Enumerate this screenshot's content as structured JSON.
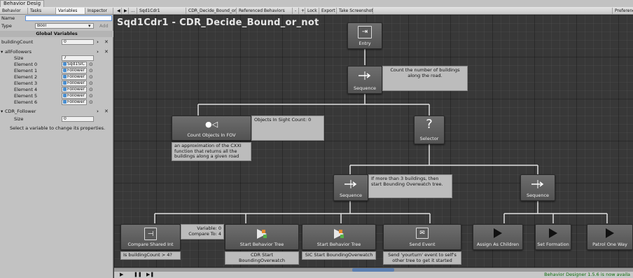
{
  "window": {
    "tab_title": "Behavior Desig"
  },
  "panel_tabs": [
    "Behavior",
    "Tasks",
    "Variables",
    "Inspector"
  ],
  "toolbar": {
    "prev": "◀",
    "next": "▶",
    "ellipsis": "...",
    "tree": "Sqd1Cdr1",
    "tree_dropdown": "CDR_Decide_Bound_or_",
    "referenced": "Referenced Behaviors",
    "minus": "-",
    "plus": "+",
    "lock": "Lock",
    "export": "Export",
    "screenshot": "Take Screenshot",
    "preferences": "Preferences"
  },
  "variables": {
    "name_label": "Name",
    "name_value": "",
    "type_label": "Type",
    "type_value": "Bool",
    "add_label": "Add",
    "global_label": "Global Variables",
    "list": [
      {
        "name": "buildingCount",
        "value": "0"
      }
    ],
    "allFollowers": {
      "name": "allFollowers",
      "size_label": "Size",
      "size_value": "7",
      "elements": [
        {
          "label": "Element 0",
          "value": "Sqd1SIC"
        },
        {
          "label": "Element 1",
          "value": "Follower"
        },
        {
          "label": "Element 2",
          "value": "Follower"
        },
        {
          "label": "Element 3",
          "value": "Follower"
        },
        {
          "label": "Element 4",
          "value": "Follower"
        },
        {
          "label": "Element 5",
          "value": "Follower"
        },
        {
          "label": "Element 6",
          "value": "Follower"
        }
      ]
    },
    "cdrFollower": {
      "name": "CDR_Follower",
      "size_label": "Size",
      "size_value": "0"
    },
    "hint": "Select a variable to change its properties."
  },
  "graph": {
    "title": "Sqd1Cdr1 - CDR_Decide_Bound_or_not",
    "nodes": {
      "entry": "Entry",
      "sequence_root": "Sequence",
      "count_objects": "Count Objects In FOV",
      "selector": "Selector",
      "sequence_left": "Sequence",
      "sequence_right": "Sequence",
      "compare": "Compare Shared Int",
      "start_bt_1": "Start Behavior Tree",
      "start_bt_2": "Start Behavior Tree",
      "send_event": "Send Event",
      "assign_children": "Assign As Children",
      "set_formation": "Set Formation",
      "patrol": "Patrol One Way"
    },
    "comments": {
      "sequence_root": "Count the number of buildings along the road.",
      "count_objects_value": "Objects In Sight Count: 0",
      "count_objects_caption": "an approximation of the CXXI function that returns all the buildings along a given road",
      "sequence_left": "If more than 3 buildings, then start Bounding Overwatch tree.",
      "compare_values": "Variable: 0\nCompare To: 4",
      "compare_caption": "Is buildingCount > 4?",
      "start_bt_1_caption": "CDR Start BoundingOverwatch",
      "start_bt_2_caption": "SIC Start BoundingOverwatch",
      "send_event_caption": "Send 'yourturn' event to self's other tree to get it started"
    }
  },
  "bottom": {
    "play": "▶",
    "pause": "❚❚",
    "step": "▶❚",
    "notice": "Behavior Designer 1.5.6 is now availa"
  },
  "colors": {
    "graph_bg": "#383838",
    "node": "#5e5e5e",
    "comment": "#bcbcbc",
    "link": "#e0e0e0",
    "notice": "#0a6e0a"
  }
}
